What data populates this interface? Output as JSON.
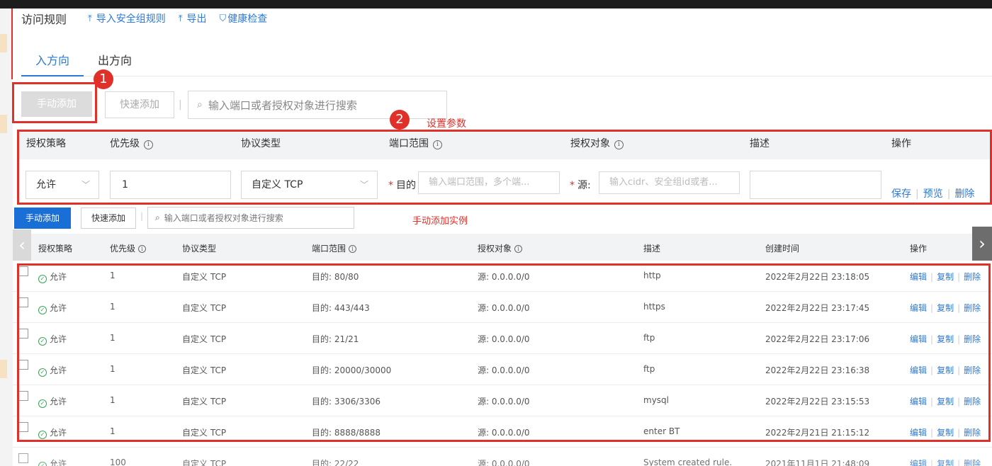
{
  "header": {
    "title": "访问规则",
    "links": [
      {
        "icon": "upload-icon",
        "label": "导入安全组规则"
      },
      {
        "icon": "export-icon",
        "label": "导出"
      },
      {
        "icon": "shield-check-icon",
        "label": "健康检查"
      }
    ]
  },
  "tabs": [
    {
      "label": "入方向",
      "active": true
    },
    {
      "label": "出方向",
      "active": false
    }
  ],
  "toolbar": {
    "manual_add": "手动添加",
    "quick_add": "快速添加",
    "search_placeholder": "输入端口或者授权对象进行搜索"
  },
  "annotations": {
    "badge1": "1",
    "badge2": "2",
    "set_params": "设置参数",
    "example": "手动添加实例",
    "color": "#e0302a"
  },
  "form": {
    "headers": {
      "policy": "授权策略",
      "priority": "优先级",
      "protocol": "协议类型",
      "port": "端口范围",
      "auth": "授权对象",
      "desc": "描述",
      "ops": "操作"
    },
    "policy_value": "允许",
    "priority_value": "1",
    "protocol_value": "自定义 TCP",
    "port_label": "目的",
    "port_placeholder": "输入端口范围，多个端...",
    "auth_label": "源:",
    "auth_placeholder": "输入cidr、安全组id或者...",
    "actions": {
      "save": "保存",
      "preview": "预览",
      "delete": "删除"
    }
  },
  "table": {
    "toolbar": {
      "manual_add": "手动添加",
      "quick_add": "快速添加",
      "search_placeholder": "输入端口或者授权对象进行搜索"
    },
    "columns": {
      "policy": "授权策略",
      "priority": "优先级",
      "protocol": "协议类型",
      "port": "端口范围",
      "auth": "授权对象",
      "desc": "描述",
      "created": "创建时间",
      "ops": "操作"
    },
    "actions": {
      "edit": "编辑",
      "copy": "复制",
      "delete": "删除"
    },
    "rows": [
      {
        "policy": "允许",
        "priority": "1",
        "protocol": "自定义 TCP",
        "port": "目的: 80/80",
        "auth": "源: 0.0.0.0/0",
        "desc": "http",
        "created": "2022年2月22日 23:18:05"
      },
      {
        "policy": "允许",
        "priority": "1",
        "protocol": "自定义 TCP",
        "port": "目的: 443/443",
        "auth": "源: 0.0.0.0/0",
        "desc": "https",
        "created": "2022年2月22日 23:17:45"
      },
      {
        "policy": "允许",
        "priority": "1",
        "protocol": "自定义 TCP",
        "port": "目的: 21/21",
        "auth": "源: 0.0.0.0/0",
        "desc": "ftp",
        "created": "2022年2月22日 23:17:06"
      },
      {
        "policy": "允许",
        "priority": "1",
        "protocol": "自定义 TCP",
        "port": "目的: 20000/30000",
        "auth": "源: 0.0.0.0/0",
        "desc": "ftp",
        "created": "2022年2月22日 23:16:38"
      },
      {
        "policy": "允许",
        "priority": "1",
        "protocol": "自定义 TCP",
        "port": "目的: 3306/3306",
        "auth": "源: 0.0.0.0/0",
        "desc": "mysql",
        "created": "2022年2月22日 23:15:53"
      },
      {
        "policy": "允许",
        "priority": "1",
        "protocol": "自定义 TCP",
        "port": "目的: 8888/8888",
        "auth": "源: 0.0.0.0/0",
        "desc": "enter BT",
        "created": "2022年2月21日 21:15:12"
      },
      {
        "policy": "允许",
        "priority": "100",
        "protocol": "自定义 TCP",
        "port": "目的: 22/22",
        "auth": "源: 0.0.0.0/0",
        "desc": "System created rule.",
        "created": "2021年11月1日 21:48:09"
      }
    ]
  }
}
